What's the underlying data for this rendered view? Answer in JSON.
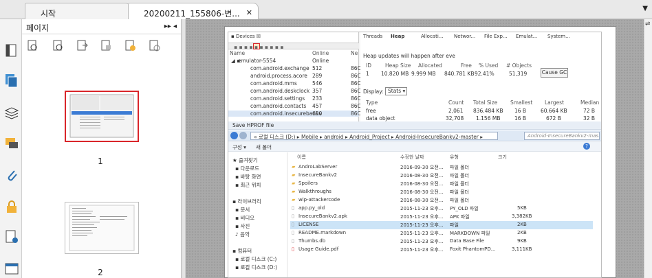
{
  "tabs": [
    {
      "label": "시작"
    },
    {
      "label": "20200211_155806-변..."
    }
  ],
  "panel": {
    "title": "페이지",
    "page1": "1",
    "page2": "2"
  },
  "devices": {
    "tab": "Devices",
    "header_name": "Name",
    "header_online": "Online",
    "header_next": "Ne",
    "rows": [
      {
        "name": "emulator-5554",
        "status": "Online",
        "pid": ""
      },
      {
        "name": "com.android.exchange",
        "status": "512",
        "pid": "86C"
      },
      {
        "name": "android.process.acore",
        "status": "289",
        "pid": "86C"
      },
      {
        "name": "com.android.mms",
        "status": "546",
        "pid": "86C"
      },
      {
        "name": "com.android.deskclock",
        "status": "357",
        "pid": "86C"
      },
      {
        "name": "com.android.settings",
        "status": "233",
        "pid": "86C"
      },
      {
        "name": "com.android.contacts",
        "status": "457",
        "pid": "86C"
      },
      {
        "name": "com.android.insecurebankv",
        "status": "650",
        "pid": "86C"
      }
    ]
  },
  "heap": {
    "tabs": [
      "Threads",
      "Heap",
      "Allocati...",
      "Networ...",
      "File Exp...",
      "Emulat...",
      "System..."
    ],
    "notice": "Heap updates will happen after eve",
    "cols": [
      "ID",
      "Heap Size",
      "Allocated",
      "Free",
      "% Used",
      "# Objects"
    ],
    "row": [
      "1",
      "10.820 MB",
      "9.999 MB",
      "840.781 KB",
      "92.41%",
      "51,319"
    ],
    "cause_gc": "Cause GC",
    "display": "Display:",
    "display_val": "Stats",
    "stat_cols": [
      "Type",
      "Count",
      "Total Size",
      "Smallest",
      "Largest",
      "Median"
    ],
    "stat_rows": [
      [
        "free",
        "2,061",
        "836.484 KB",
        "16 B",
        "60.664 KB",
        "72 B"
      ],
      [
        "data object",
        "32,708",
        "1.156 MB",
        "16 B",
        "672 B",
        "32 B"
      ]
    ]
  },
  "dialog": {
    "title": "Save HPROF file",
    "path": [
      "« 로컬 디스크 (D:)",
      "Mobile",
      "android",
      "Android_Project",
      "Android-InsecureBankv2-master"
    ],
    "search_placeholder": "Android-InsecureBankv2-mas...",
    "organize": "구성 ▾",
    "new_folder": "새 폴더",
    "nav": [
      "즐겨찾기",
      "다운로드",
      "바탕 화면",
      "최근 위치",
      "라이브러리",
      "문서",
      "비디오",
      "사진",
      "음악",
      "컴퓨터",
      "로컬 디스크 (C:)",
      "로컬 디스크 (D:)"
    ],
    "headers": [
      "이름",
      "수정한 날짜",
      "유형",
      "크기"
    ],
    "files": [
      [
        "AndroLabServer",
        "2016-09-30 오전...",
        "파일 폴더",
        ""
      ],
      [
        "InsecureBankv2",
        "2016-08-30 오전...",
        "파일 폴더",
        ""
      ],
      [
        "Spoilers",
        "2016-08-30 오전...",
        "파일 폴더",
        ""
      ],
      [
        "Walkthroughs",
        "2016-08-30 오전...",
        "파일 폴더",
        ""
      ],
      [
        "wip-attackercode",
        "2016-08-30 오전...",
        "파일 폴더",
        ""
      ],
      [
        "app.py_old",
        "2015-11-23 오후...",
        "PY_OLD 파일",
        "5KB"
      ],
      [
        "InsecureBankv2.apk",
        "2015-11-23 오후...",
        "APK 파일",
        "3,382KB"
      ],
      [
        "LICENSE",
        "2015-11-23 오후...",
        "파일",
        "2KB"
      ],
      [
        "README.markdown",
        "2015-11-23 오후...",
        "MARKDOWN 파일",
        "2KB"
      ],
      [
        "Thumbs.db",
        "2015-11-23 오후...",
        "Data Base File",
        "9KB"
      ],
      [
        "Usage Guide.pdf",
        "2015-11-23 오후...",
        "Foxit PhantomPD...",
        "3,111KB"
      ]
    ]
  },
  "colors": {
    "accent": "#d9252a",
    "folder": "#e8b84a"
  }
}
